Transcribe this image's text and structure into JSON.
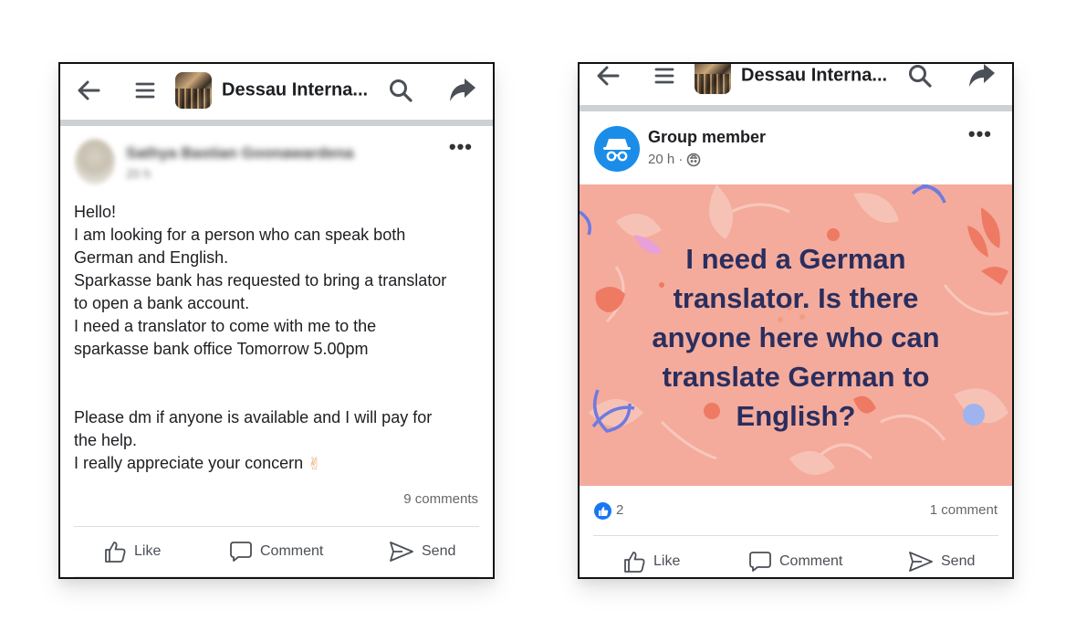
{
  "left_post": {
    "topbar": {
      "title": "Dessau Interna...",
      "icons": [
        "back-arrow-icon",
        "menu-icon",
        "group-avatar",
        "search-icon",
        "share-icon"
      ]
    },
    "author": {
      "name": "Sathya Bastian Goonawardena",
      "meta": "20 h"
    },
    "more": "•••",
    "body": {
      "l1": "Hello!",
      "l2": "I am looking for a person who can speak both",
      "l3": "German and English.",
      "l4": "Sparkasse bank has requested to bring a translator",
      "l5": "to open a bank account.",
      "l6": "I need a translator to come with me to the",
      "l7": "sparkasse bank office Tomorrow 5.00pm",
      "l8": "Please dm if anyone is available and I will pay for",
      "l9": "the help.",
      "l10": "I really appreciate your concern",
      "emoji": "✌"
    },
    "comments": "9 comments",
    "actions": {
      "like": "Like",
      "comment": "Comment",
      "send": "Send"
    }
  },
  "right_post": {
    "topbar": {
      "title": "Dessau Interna..."
    },
    "author": {
      "name": "Group member",
      "meta": "20 h ·"
    },
    "more": "•••",
    "banner_text": "I need a German\ntranslator. Is there\nanyone here who can\ntranslate German to\nEnglish?",
    "reactions": {
      "count": "2",
      "comments": "1 comment"
    },
    "actions": {
      "like": "Like",
      "comment": "Comment",
      "send": "Send"
    }
  },
  "colors": {
    "banner_bg": "#f4ab9c",
    "banner_text": "#2a2e5e",
    "facebook_blue": "#1877f2",
    "anon_avatar": "#1b8de8",
    "divider": "#cdd0d4"
  }
}
